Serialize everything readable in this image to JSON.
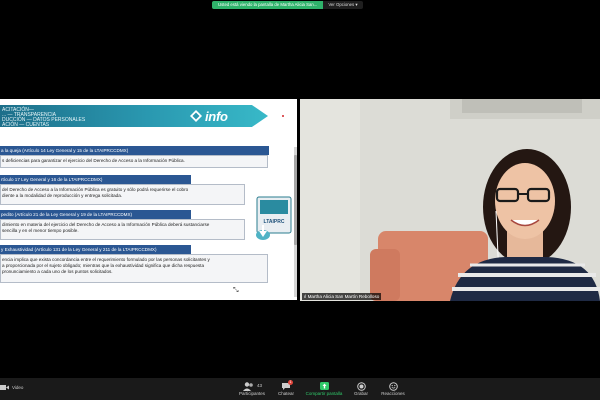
{
  "banner": {
    "sharing_text": "Usted está viendo la pantalla de Martha Alicia San...",
    "options_label": "Ver Opciones"
  },
  "slide": {
    "heading_lines": [
      "ACITACIÓN—",
      "... — TRANSPARENCIA",
      "DUCCIÓN — DATOS PERSONALES",
      "ACIÓN — CUENTAS"
    ],
    "logo_text": "info",
    "sections": [
      {
        "header": "a la queja (Artículo 14 Ley General y 15 de la LTAIPRCCDMX)",
        "lines": [
          "s deficiencias para garantizar el ejercicio del Derecho de Acceso a la Información Pública."
        ]
      },
      {
        "header": "rtículo 17 Ley General y 16 de la LTAIPRCCDMX)",
        "lines": [
          "del Derecho de Acceso a la Información Pública es gratuito y sólo podrá requerirse el cobro",
          "diente a la modalidad de reproducción y entrega solicitada."
        ]
      },
      {
        "header": "pedito (Artículo 21 de la Ley General y 19 de la LTAIPRCCDMX)",
        "lines": [
          "dimiento en materia del ejercicio del Derecho de Acceso a la Información Pública deberá sustanciarse",
          "sencilla y en el menor tiempo posible."
        ]
      },
      {
        "header": "y Exhaustividad (Artículo 131 de la Ley General y 211 de la LTAIPRCCDMX)",
        "lines": [
          "encia implica que exista concordancia entre el requerimiento formulado por las personas solicitantes y",
          "a proporcionada por el sujeto obligado; mientras que la exhaustividad significa que dicha respuesta",
          "pronunciamiento a cada uno de los puntos solicitados."
        ]
      }
    ],
    "badge_label": "LTAIPRC"
  },
  "video": {
    "participant_name": "Martha Alicia San Martín Rebolloso"
  },
  "toolbar": {
    "video_label": "Video",
    "items": [
      {
        "label": "Participantes",
        "count": "43"
      },
      {
        "label": "Chatear",
        "badge": "1"
      },
      {
        "label": "Compartir pantalla"
      },
      {
        "label": "Grabar"
      },
      {
        "label": "Reacciones"
      }
    ]
  },
  "colors": {
    "share_green": "#2fb36b",
    "slide_banner": "#2a98b0",
    "section_header": "#2b5793",
    "toolbar_bg": "#1a1a1a"
  }
}
